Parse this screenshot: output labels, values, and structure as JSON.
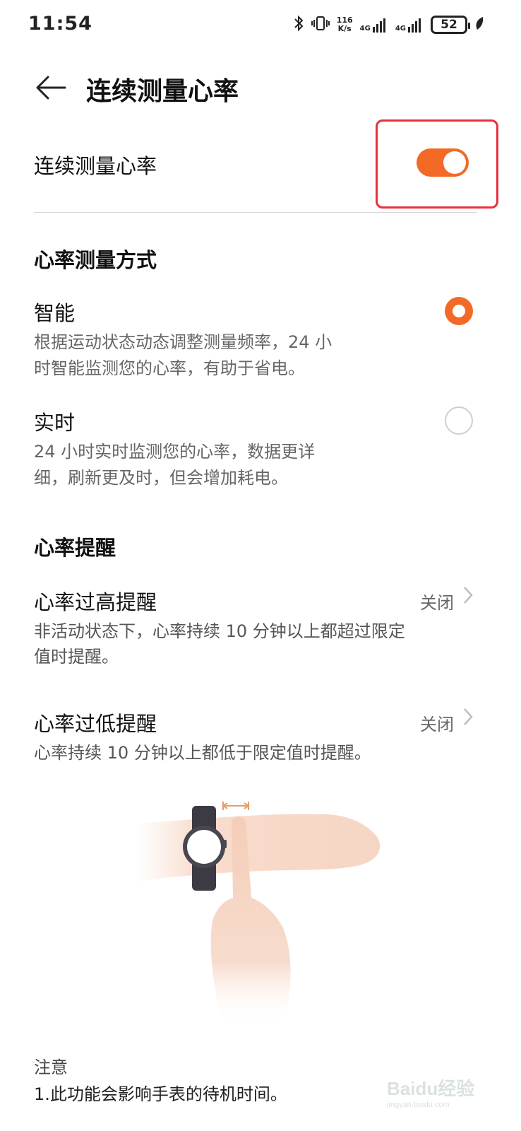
{
  "status_bar": {
    "time": "11:54",
    "net_speed_value": "116",
    "net_speed_unit": "K/s",
    "signal1_label": "4G",
    "signal2_label": "4G",
    "battery_level": "52"
  },
  "header": {
    "title": "连续测量心率"
  },
  "continuous_toggle": {
    "label": "连续测量心率",
    "on": true
  },
  "measure_mode": {
    "section_title": "心率测量方式",
    "options": [
      {
        "title": "智能",
        "desc_line1": "根据运动状态动态调整测量频率，24 小",
        "desc_line2": "时智能监测您的心率，有助于省电。",
        "selected": true
      },
      {
        "title": "实时",
        "desc_line1": "24 小时实时监测您的心率，数据更详",
        "desc_line2": "细，刷新更及时，但会增加耗电。",
        "selected": false
      }
    ]
  },
  "reminders": {
    "section_title": "心率提醒",
    "items": [
      {
        "title": "心率过高提醒",
        "value": "关闭",
        "desc_line1": "非活动状态下，心率持续 10 分钟以上都超过限定",
        "desc_line2": "值时提醒。"
      },
      {
        "title": "心率过低提醒",
        "value": "关闭",
        "desc_line1": "心率持续 10 分钟以上都低于限定值时提醒。",
        "desc_line2": ""
      }
    ]
  },
  "note": {
    "title": "注意",
    "line1": "1.此功能会影响手表的待机时间。"
  },
  "watermark": {
    "text": "Baidu经验",
    "subtext": "jingyan.baidu.com"
  },
  "colors": {
    "accent": "#f36a26",
    "highlight_border": "#e8303f"
  },
  "icons": {
    "back": "arrow-left-icon",
    "chevron": "chevron-right-icon"
  }
}
